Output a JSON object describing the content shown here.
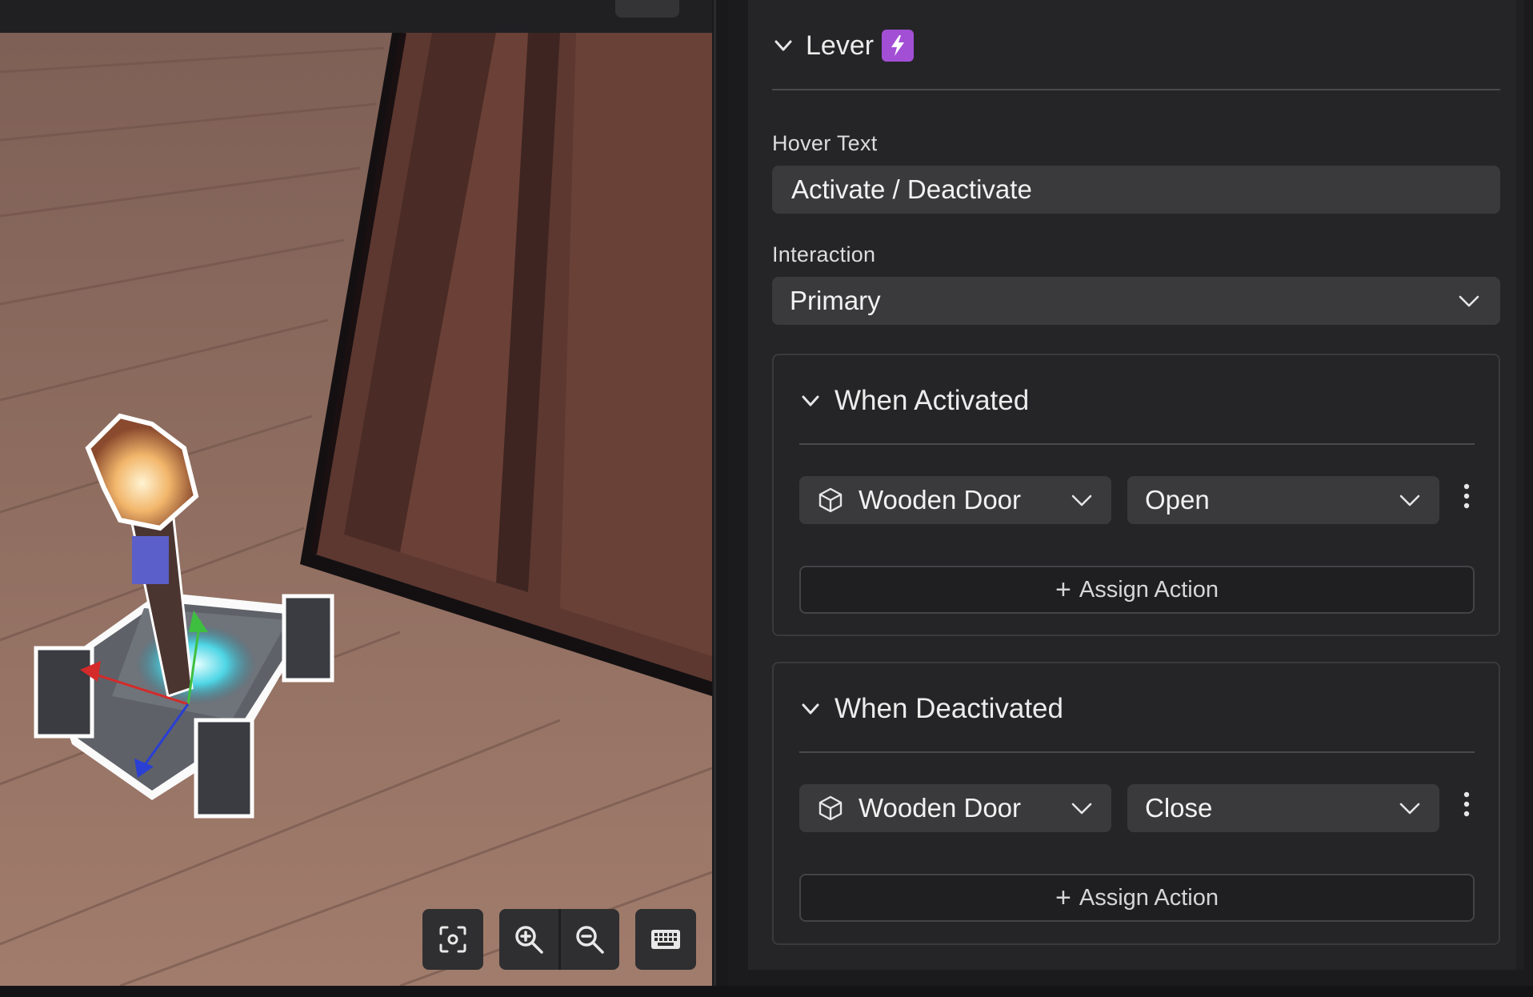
{
  "viewport": {
    "controls": {
      "focus": "focus-icon",
      "zoom_in": "zoom-in-icon",
      "zoom_out": "zoom-out-icon",
      "keyboard": "keyboard-icon"
    }
  },
  "inspector": {
    "component_title": "Lever",
    "component_icon": "lightning-icon",
    "accent_color": "#a24fd6",
    "hover_text": {
      "label": "Hover Text",
      "value": "Activate / Deactivate"
    },
    "interaction": {
      "label": "Interaction",
      "value": "Primary"
    },
    "events": [
      {
        "title": "When Activated",
        "target": "Wooden Door",
        "action": "Open",
        "assign_label": "Assign Action"
      },
      {
        "title": "When Deactivated",
        "target": "Wooden Door",
        "action": "Close",
        "assign_label": "Assign Action"
      }
    ]
  }
}
